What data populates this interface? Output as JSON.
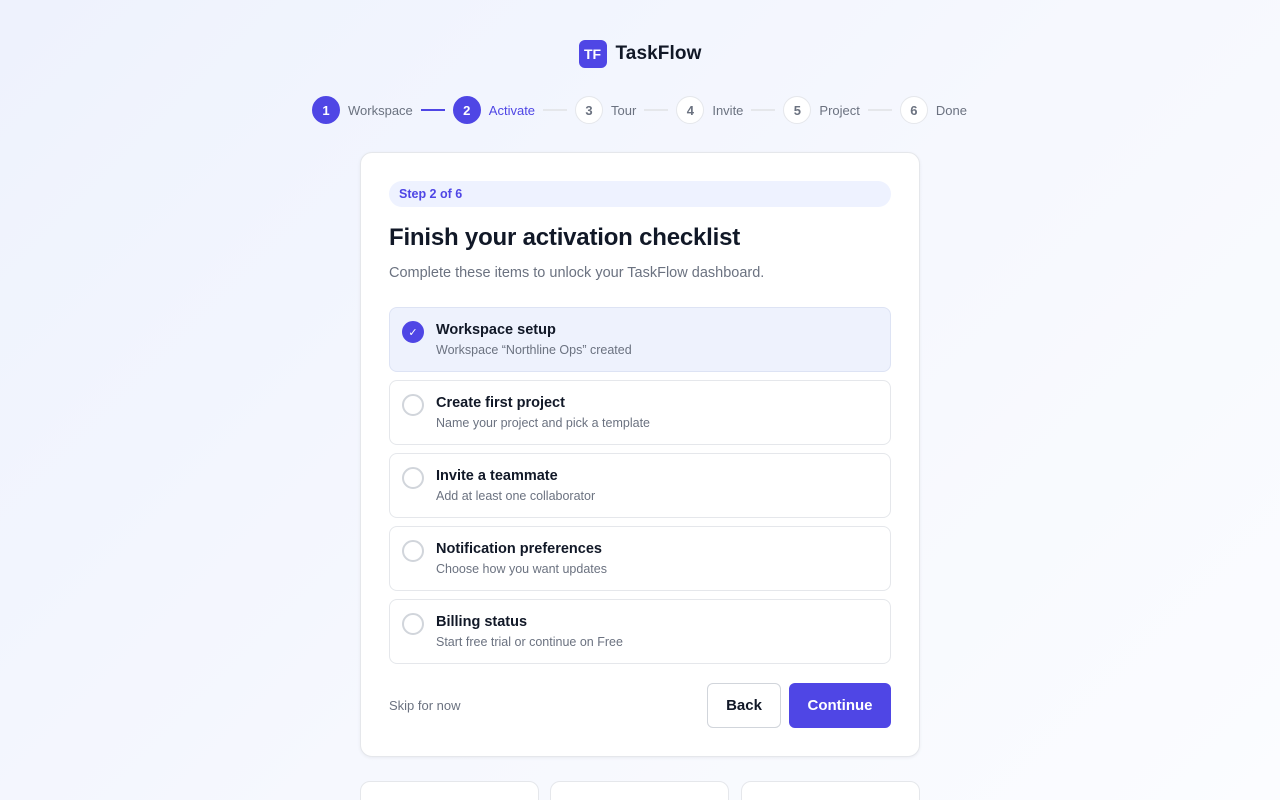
{
  "brand": {
    "logo_text": "TF",
    "name": "TaskFlow",
    "accent": "#4f46e5"
  },
  "stepper": {
    "steps": [
      {
        "number": "1",
        "label": "Workspace",
        "state": "completed"
      },
      {
        "number": "2",
        "label": "Activate",
        "state": "current"
      },
      {
        "number": "3",
        "label": "Tour",
        "state": "upcoming"
      },
      {
        "number": "4",
        "label": "Invite",
        "state": "upcoming"
      },
      {
        "number": "5",
        "label": "Project",
        "state": "upcoming"
      },
      {
        "number": "6",
        "label": "Done",
        "state": "upcoming"
      }
    ]
  },
  "card": {
    "badge": "Step 2 of 6",
    "title": "Finish your activation checklist",
    "subtitle": "Complete these items to unlock your TaskFlow dashboard.",
    "checklist": [
      {
        "title": "Workspace setup",
        "description": "Workspace “Northline Ops” created",
        "checked": true
      },
      {
        "title": "Create first project",
        "description": "Name your project and pick a template",
        "checked": false
      },
      {
        "title": "Invite a teammate",
        "description": "Add at least one collaborator",
        "checked": false
      },
      {
        "title": "Notification preferences",
        "description": "Choose how you want updates",
        "checked": false
      },
      {
        "title": "Billing status",
        "description": "Start free trial or continue on Free",
        "checked": false
      }
    ],
    "check_glyph": "✓",
    "skip_label": "Skip for now",
    "back_label": "Back",
    "continue_label": "Continue"
  }
}
